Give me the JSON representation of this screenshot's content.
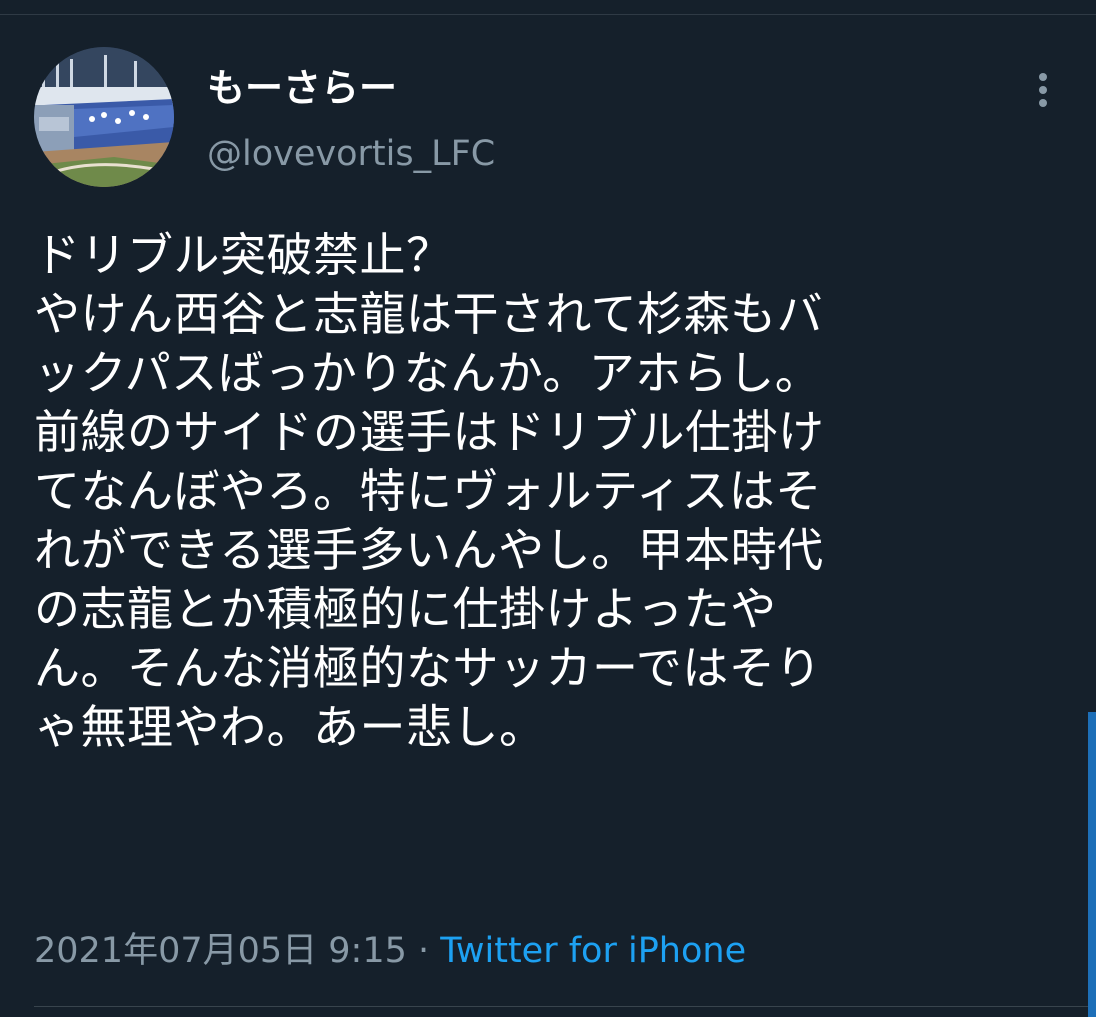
{
  "tweet": {
    "display_name": "もーさらー",
    "handle": "@lovevortis_LFC",
    "text_lines": [
      "ドリブル突破禁止？",
      "やけん西谷と志龍は干されて杉森もバ",
      "ックパスばっかりなんか。アホらし。",
      "前線のサイドの選手はドリブル仕掛け",
      "てなんぼやろ。特にヴォルティスはそ",
      "れができる選手多いんやし。甲本時代",
      "の志龍とか積極的に仕掛けよったや",
      "ん。そんな消極的なサッカーではそり",
      "ゃ無理やわ。あー悲し。"
    ],
    "timestamp": "2021年07月05日 9:15",
    "separator": "·",
    "source": "Twitter for iPhone"
  },
  "icons": {
    "more": "more-vertical-icon",
    "avatar": "stadium-photo-avatar"
  },
  "colors": {
    "background": "#15202b",
    "text_primary": "#ffffff",
    "text_secondary": "#8899a6",
    "link": "#1da1f2"
  }
}
